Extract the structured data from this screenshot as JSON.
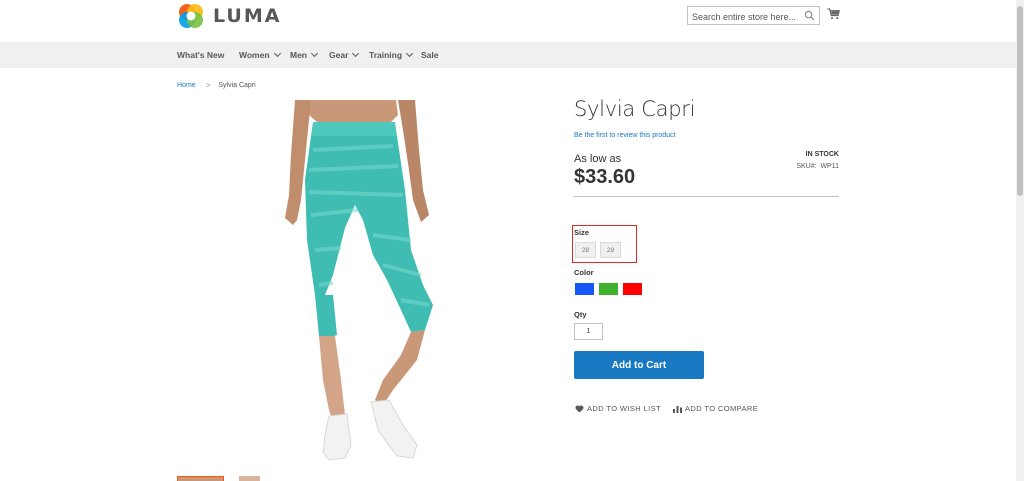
{
  "header": {
    "logo_text": "LUMA",
    "search_placeholder": "Search entire store here..."
  },
  "nav": {
    "items": [
      {
        "label": "What's New",
        "has_dropdown": false
      },
      {
        "label": "Women",
        "has_dropdown": true
      },
      {
        "label": "Men",
        "has_dropdown": true
      },
      {
        "label": "Gear",
        "has_dropdown": true
      },
      {
        "label": "Training",
        "has_dropdown": true
      },
      {
        "label": "Sale",
        "has_dropdown": false
      }
    ]
  },
  "breadcrumb": {
    "home": "Home",
    "separator": ">",
    "current": "Sylvia Capri"
  },
  "product": {
    "name": "Sylvia Capri",
    "review_link": "Be the first to review this product",
    "price_label": "As low as",
    "price": "$33.60",
    "stock": "IN STOCK",
    "sku_label": "SKU#:",
    "sku": "WP11"
  },
  "options": {
    "size_label": "Size",
    "sizes": [
      "28",
      "29"
    ],
    "color_label": "Color",
    "colors": [
      {
        "name": "Blue",
        "hex": "#1857f7"
      },
      {
        "name": "Green",
        "hex": "#3fb22b"
      },
      {
        "name": "Red",
        "hex": "#ff0000"
      }
    ],
    "qty_label": "Qty",
    "qty_value": "1"
  },
  "actions": {
    "add_to_cart": "Add to Cart",
    "wishlist": "ADD TO WISH LIST",
    "compare": "ADD TO COMPARE"
  },
  "colors": {
    "brand_blue": "#1979c3",
    "nav_bg": "#f0f0f0",
    "highlight": "#e02b27",
    "pants": "#3fbdb3"
  }
}
